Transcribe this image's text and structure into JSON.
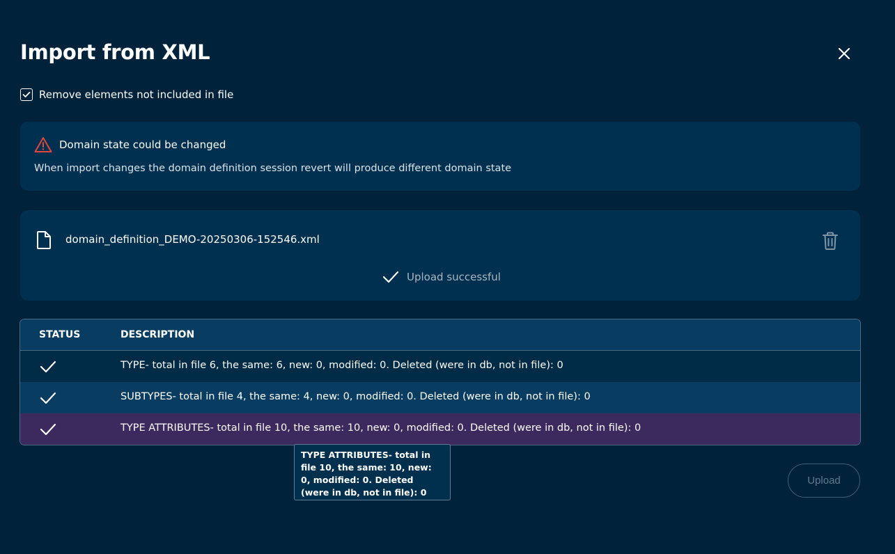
{
  "dialog": {
    "title": "Import from XML"
  },
  "options": {
    "remove_elements_label": "Remove elements not included in file",
    "remove_elements_checked": true
  },
  "warning": {
    "title": "Domain state could be changed",
    "text": "When import changes the domain definition session revert will produce different domain state",
    "icon": "warning-triangle-icon",
    "icon_color": "#e0473e"
  },
  "file": {
    "name": "domain_definition_DEMO-20250306-152546.xml",
    "status": "Upload successful"
  },
  "table": {
    "headers": [
      "STATUS",
      "DESCRIPTION"
    ],
    "rows": [
      {
        "status": "check-icon",
        "description": "TYPE- total in file 6, the same: 6, new: 0, modified: 0. Deleted (were in db, not in file): 0"
      },
      {
        "status": "check-icon",
        "description": "SUBTYPES- total in file 4, the same: 4, new: 0, modified: 0. Deleted (were in db, not in file): 0"
      },
      {
        "status": "check-icon",
        "description": "TYPE ATTRIBUTES- total in file 10, the same: 10, new: 0, modified: 0. Deleted (were in db, not in file): 0"
      }
    ]
  },
  "tooltip": {
    "text": "TYPE ATTRIBUTES- total in file 10, the same: 10, new: 0, modified: 0. Deleted (were in db, not in file): 0"
  },
  "actions": {
    "upload_label": "Upload"
  },
  "colors": {
    "background": "#00233b",
    "panel": "#003050",
    "highlight_row": "#3c2a5e"
  }
}
